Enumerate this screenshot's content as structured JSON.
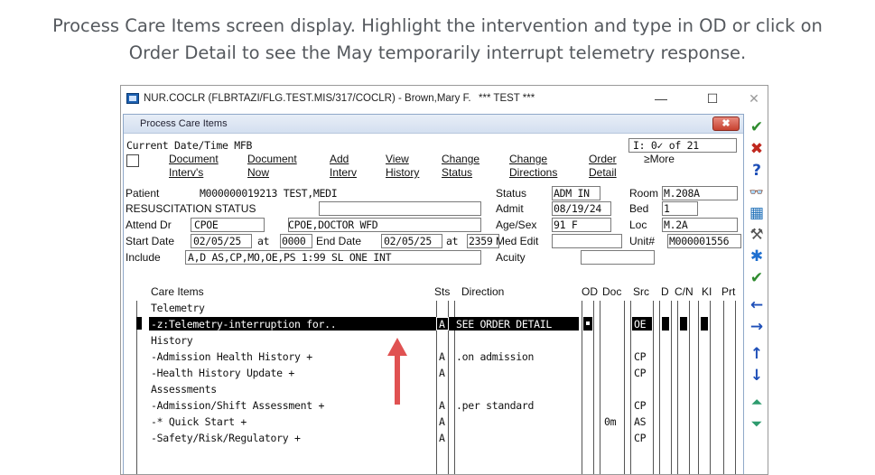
{
  "caption": {
    "line1": "Process Care Items screen display.  Highlight the intervention and type in OD or click on",
    "line2": "Order Detail to see the May temporarily interrupt telemetry response."
  },
  "window": {
    "title": "NUR.COCLR (FLBRTAZI/FLG.TEST.MIS/317/COCLR) - Brown,Mary F.",
    "test_label": "*** TEST ***",
    "minimize": "—",
    "maximize": "☐",
    "close": "✕"
  },
  "panel": {
    "title": "Process Care Items",
    "close": "✖"
  },
  "header": {
    "current": "Current Date/Time MFB",
    "counter": "I: 0✓ of 21"
  },
  "menu": [
    {
      "l1": "Document",
      "l2": "Interv's"
    },
    {
      "l1": "Document",
      "l2": "Now"
    },
    {
      "l1": "Add",
      "l2": "Interv"
    },
    {
      "l1": "View",
      "l2": "History"
    },
    {
      "l1": "Change",
      "l2": "Status"
    },
    {
      "l1": "Change",
      "l2": "Directions"
    },
    {
      "l1": "Order",
      "l2": "Detail"
    },
    {
      "l1": "≥More",
      "l2": ""
    }
  ],
  "patient": {
    "patient_label": "Patient",
    "patient_value": "M000000019213 TEST,MEDI",
    "resus_label": "RESUSCITATION STATUS",
    "attend_label": "Attend Dr",
    "attend_code": "CPOE",
    "attend_name": "CPOE,DOCTOR WFD",
    "start_label": "Start Date",
    "start_date": "02/05/25",
    "at1": "at",
    "start_time": "0000",
    "end_label": "End Date",
    "end_date": "02/05/25",
    "at2": "at",
    "end_time": "2359",
    "include_label": "Include",
    "include_value": "A,D AS,CP,MO,OE,PS 1:99 SL ONE INT",
    "status_label": "Status",
    "status_value": "ADM IN",
    "admit_label": "Admit",
    "admit_value": "08/19/24",
    "age_label": "Age/Sex",
    "age_value": "91 F",
    "med_label": "Med Edit",
    "acuity_label": "Acuity",
    "room_label": "Room",
    "room_value": "M.208A",
    "bed_label": "Bed",
    "bed_value": "1",
    "loc_label": "Loc",
    "loc_value": "M.2A",
    "unit_label": "Unit#",
    "unit_value": "M000001556"
  },
  "columns": {
    "care": "Care Items",
    "sts": "Sts",
    "dir": "Direction",
    "od": "OD",
    "doc": "Doc",
    "src": "Src",
    "d": "D",
    "cn": "C/N",
    "ki": "KI",
    "prt": "Prt"
  },
  "rows": [
    {
      "care": "Telemetry",
      "sts": "",
      "dir": "",
      "doc": "",
      "src": ""
    },
    {
      "care": " -z:Telemetry-interruption for..",
      "sts": "A",
      "dir": "SEE ORDER DETAIL",
      "doc": "",
      "src": "OE",
      "selected": true
    },
    {
      "care": "History",
      "sts": "",
      "dir": "",
      "doc": "",
      "src": ""
    },
    {
      "care": " -Admission Health History +",
      "sts": "A",
      "dir": ".on admission",
      "doc": "",
      "src": "CP"
    },
    {
      "care": " -Health History Update +",
      "sts": "A",
      "dir": "",
      "doc": "",
      "src": "CP"
    },
    {
      "care": "Assessments",
      "sts": "",
      "dir": "",
      "doc": "",
      "src": ""
    },
    {
      "care": " -Admission/Shift Assessment +",
      "sts": "A",
      "dir": ".per standard",
      "doc": "",
      "src": "CP"
    },
    {
      "care": " -* Quick Start +",
      "sts": "A",
      "dir": "",
      "doc": "0m",
      "src": "AS"
    },
    {
      "care": " -Safety/Risk/Regulatory +",
      "sts": "A",
      "dir": "",
      "doc": "",
      "src": "CP"
    }
  ],
  "toolbar": [
    {
      "icon": "check-icon",
      "glyph": "✔",
      "color": "#2e8b2e"
    },
    {
      "icon": "cancel-icon",
      "glyph": "✖",
      "color": "#c0281e"
    },
    {
      "icon": "help-icon",
      "glyph": "?",
      "color": "#1e4fb8"
    },
    {
      "icon": "binoculars-icon",
      "glyph": "👓",
      "color": "#333333"
    },
    {
      "icon": "calendar-icon",
      "glyph": "▦",
      "color": "#1e6fb8"
    },
    {
      "icon": "wrench-icon",
      "glyph": "⚒",
      "color": "#555555"
    },
    {
      "icon": "asterisk-icon",
      "glyph": "✱",
      "color": "#1e6fd0"
    },
    {
      "icon": "check-all-icon",
      "glyph": "✔",
      "color": "#2e8b2e"
    },
    {
      "icon": "arrow-left-icon",
      "glyph": "←",
      "color": "#1e4fb8"
    },
    {
      "icon": "arrow-right-icon",
      "glyph": "→",
      "color": "#1e4fb8"
    },
    {
      "icon": "arrow-up-icon",
      "glyph": "↑",
      "color": "#1e4fb8"
    },
    {
      "icon": "arrow-down-icon",
      "glyph": "↓",
      "color": "#1e4fb8"
    },
    {
      "icon": "page-up-icon",
      "glyph": "⏶",
      "color": "#2e9b6e"
    },
    {
      "icon": "page-down-icon",
      "glyph": "⏷",
      "color": "#2e9b6e"
    }
  ],
  "colors": {
    "highlight": "#000000",
    "arrow": "#e05252",
    "caption": "#55595e"
  }
}
